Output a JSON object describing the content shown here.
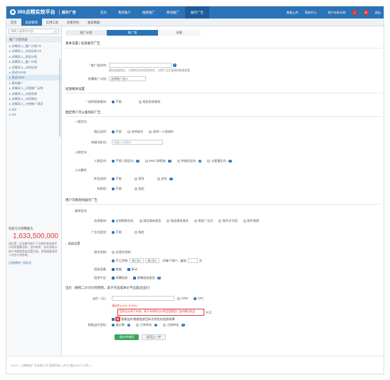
{
  "header": {
    "brand": "360点睛实效平台",
    "subtitle": "展示广告",
    "nav": [
      "首页",
      "我的账户",
      "搜索推广",
      "移动推广",
      "展示广告"
    ],
    "active_nav": 4,
    "right": [
      "数据上传",
      "帮助中心",
      "用户名称示例",
      "退出"
    ],
    "badge": "1"
  },
  "subnav": [
    "首页",
    "投放管理",
    "实用工具",
    "效果评估",
    "报表数据"
  ],
  "sidebar": {
    "search_placeholder": "请输入搜索的内容",
    "title": "推广计划列表",
    "items": [
      "点睛导入_推广计划 #1",
      "点睛导入_计划示例 #2",
      "点睛导入_测试计划",
      "点睛导入_推广计划",
      "点睛导入_计划示例",
      "测试12345",
      "测试1234",
      "我的推广",
      "点睛导入_计划推广示例",
      "点睛导入_计划名称",
      "点睛导入_计划测试",
      "点睛导入_计划推广测试",
      "222",
      "111"
    ],
    "active_index": 6,
    "budget_label": "您账号日预算额为",
    "budget_value": "1,633,500,000",
    "budget_note": "请注意：此金额为账户下当前所有投放中计划的预算总和，仅供参考，实际消耗以账户余额和投放设置为准，如需调整请进入对应计划修改。",
    "budget_link": "已选择的广告形式"
  },
  "steps": [
    "推广计划",
    "推广组",
    "创意"
  ],
  "form": {
    "basic_title": "基本设置 | 投放展示广告",
    "plan_name_label": "推广组名称：",
    "plan_name_hint": "建议投放地区，人群和活动内容来命名，以便于日后管理和数据查看",
    "plan_select_label": "所属推广计划：",
    "plan_select_value": "选择推广组",
    "media_section": "投放媒体设置",
    "media_label": "* 选择投放媒体：",
    "media_options": [
      "不限",
      "指定投放媒体"
    ],
    "audience_section": "圈定用户可以看到的广告",
    "general_head": "一般定向",
    "region_label": "地区选择：",
    "region_options": [
      "不限",
      "选择省份",
      "选择一二线城市"
    ],
    "keyword_label": "关键词定向：",
    "keyword_placeholder": "请输入关键词",
    "crowd_head": "人群定向",
    "crowd_label": "人群定向：",
    "crowd_options": [
      "不限人群定向",
      "360人群智能",
      "关键词定向",
      "访客重定向"
    ],
    "demo_head": "人口属性",
    "gender_label": "性别选择：",
    "gender_options": [
      "不限",
      "男性",
      "女性"
    ],
    "age_label": "年龄段：",
    "age_options": [
      "不限",
      "指定"
    ],
    "display_section": "用户可看到的展示广告",
    "display_head": "媒体定向",
    "display_label": "选择媒体：",
    "display_options": [
      "全网智能优化",
      "指定媒体类型",
      "指定媒体域名",
      "指定广告位",
      "图片文字组",
      "图片视频"
    ],
    "ad_pos_label": "广告位类型：",
    "ad_pos_options": [
      "不限",
      "指定"
    ],
    "advanced_head": "高级设置",
    "freq_label": "频次控制：",
    "freq_options": [
      "无频次控制",
      "手工控制"
    ],
    "freq_detail_a": "每1天",
    "freq_detail_b": "每1次",
    "freq_detail_c": "对每个用户，展现",
    "freq_detail_d": "次",
    "device_label": "投放设备：",
    "device_options": [
      "电脑",
      "移动"
    ],
    "platform_label": "投放平台：",
    "platform_options": [
      "屏幕投放",
      "屏幕投放类型"
    ],
    "bid_section": "出价（按照二价计价的原则，高于点击成本价不应超过出价）",
    "bid_label": "出价（元）：",
    "bid_units": [
      "CPM",
      "CPC"
    ],
    "bid_error": "请出价0.6元~5.50元",
    "bid_tip": "您的出价高于市场，高于市场的出价将会提高您广告的曝光机会",
    "bid_tip2": "以上",
    "opt_label": "智能出价：",
    "opt_badge": "新",
    "opt_text": "智能出价根据投放目标为您优化投放效果",
    "mode_label": "智能出价目标：",
    "mode_options": [
      "展示数",
      "订单转化",
      "注册转化"
    ],
    "save_button": "保存并继续",
    "back_button": "返回上一步"
  },
  "footer": "©2017 上海聚效广告有限公司 版权所有 | 沪ICP备14037719号-1",
  "colors": {
    "primary": "#2b73b7",
    "error": "#e03c3c",
    "success": "#3aa35b"
  }
}
